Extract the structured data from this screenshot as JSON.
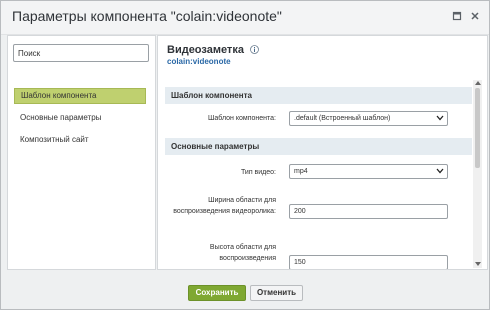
{
  "window": {
    "title": "Параметры компонента \"colain:videonote\""
  },
  "sidebar": {
    "search_placeholder": "Поиск",
    "items": [
      {
        "label": "Шаблон компонента",
        "active": true
      },
      {
        "label": "Основные параметры",
        "active": false
      },
      {
        "label": "Композитный сайт",
        "active": false
      }
    ]
  },
  "main": {
    "title": "Видеозаметка",
    "subtitle": "colain:videonote",
    "sections": [
      {
        "header": "Шаблон компонента",
        "fields": [
          {
            "label": "Шаблон компонента:",
            "type": "select",
            "value": ".default (Встроенный шаблон)"
          }
        ]
      },
      {
        "header": "Основные параметры",
        "fields": [
          {
            "label": "Тип видео:",
            "type": "select",
            "value": "mp4"
          },
          {
            "label": "Ширина области для воспроизведения видеоролика:",
            "type": "input",
            "value": "200"
          },
          {
            "label": "Высота области для воспроизведения",
            "type": "input",
            "value": "150"
          }
        ]
      }
    ]
  },
  "footer": {
    "save_label": "Сохранить",
    "cancel_label": "Отменить"
  },
  "colors": {
    "accent_green": "#7fa832",
    "active_item": "#bfd06f",
    "link_blue": "#2a68a6",
    "section_bg": "#e5ecf1"
  },
  "icons": {
    "expand": "expand-icon",
    "close": "close-icon",
    "info": "info-icon",
    "chevron": "chevron-down-icon"
  }
}
